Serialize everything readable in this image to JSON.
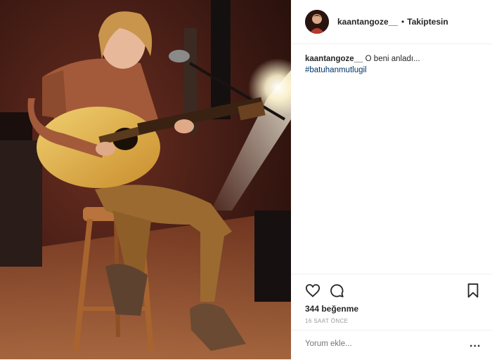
{
  "post": {
    "image_alt": "musician-with-acoustic-guitar-photo",
    "header": {
      "username": "kaantangoze__",
      "separator": "•",
      "follow_label": "Takiptesin"
    },
    "caption": {
      "username": "kaantangoze__",
      "text": "O beni anladı...",
      "hashtag": "#batuhanmutlugil"
    },
    "actions": {
      "like_icon": "heart-icon",
      "comment_icon": "comment-icon",
      "save_icon": "bookmark-icon"
    },
    "likes_text": "344 beğenme",
    "timestamp": "16 SAAT ÖNCE",
    "comment_placeholder": "Yorum ekle...",
    "more_label": "..."
  },
  "colors": {
    "hashtag": "#003569",
    "border": "#efefef",
    "muted": "#999999"
  }
}
